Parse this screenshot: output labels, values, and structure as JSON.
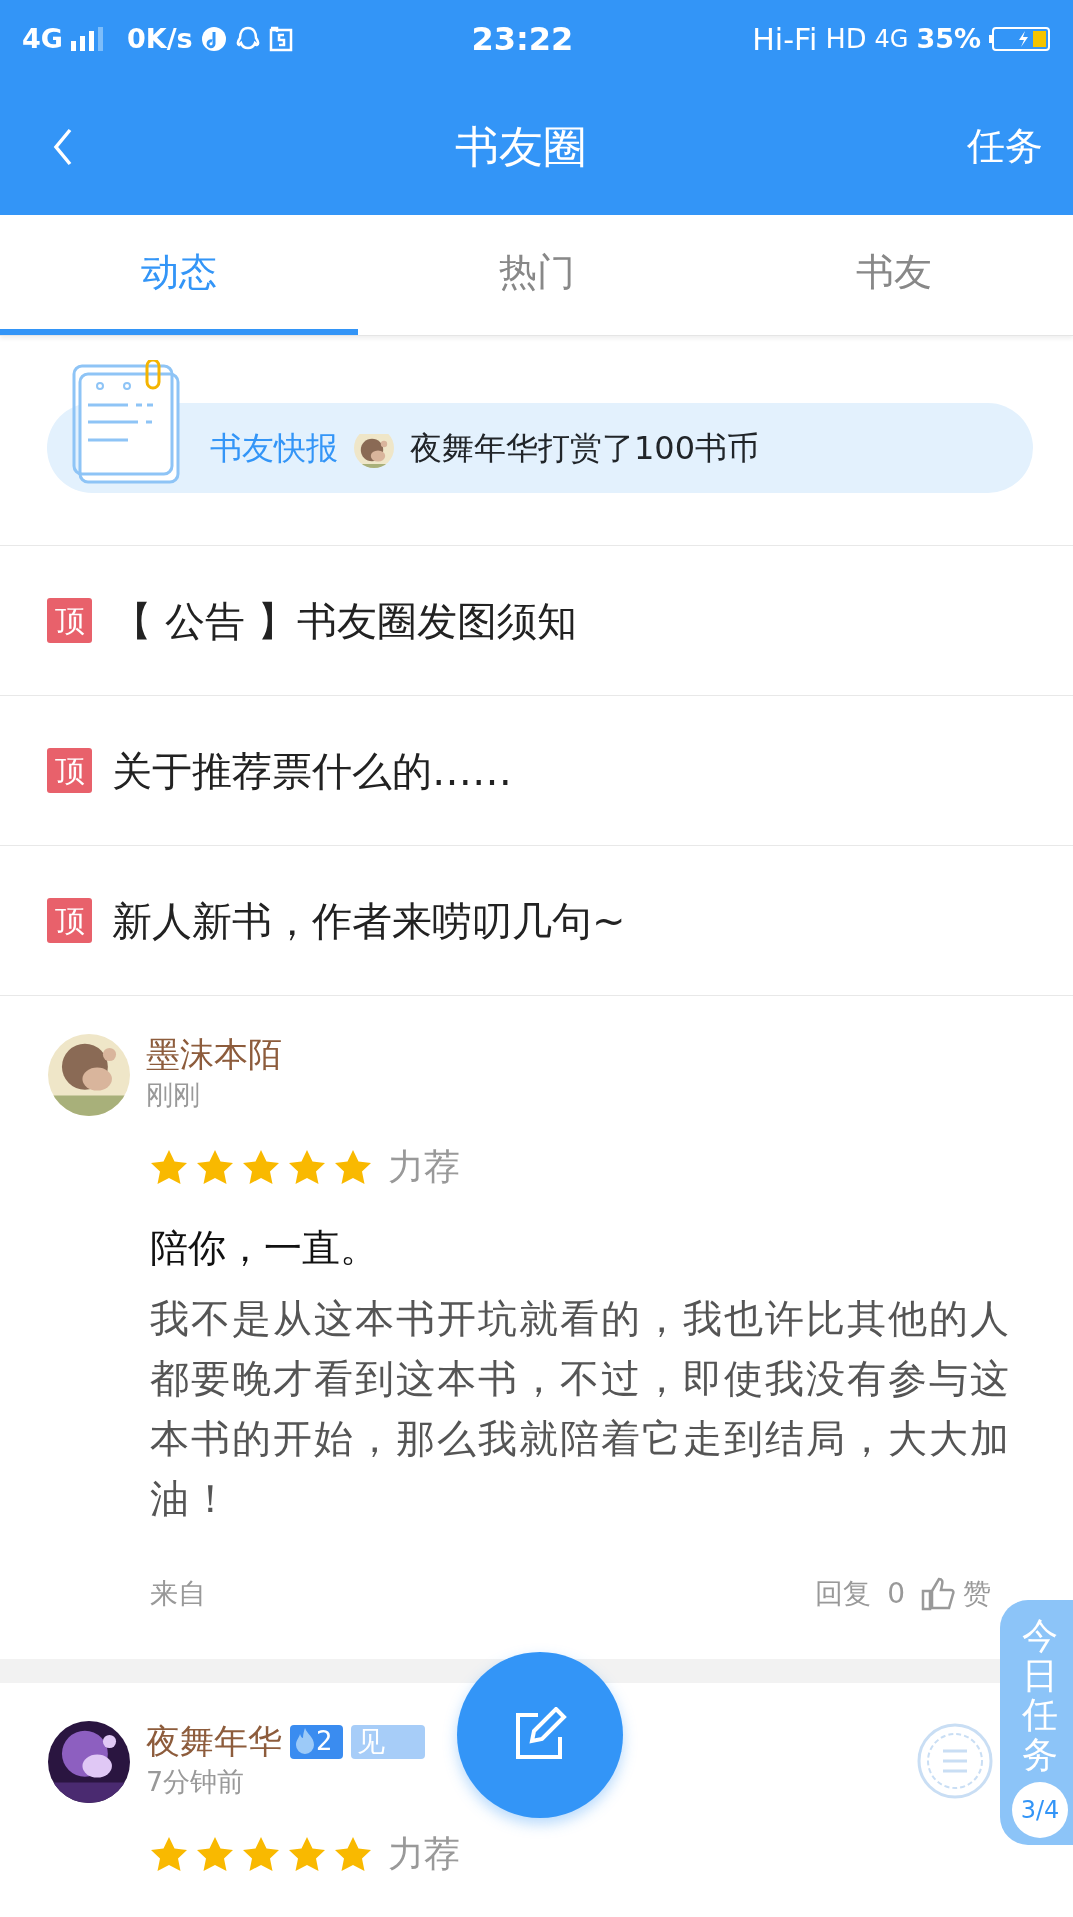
{
  "status_bar": {
    "network": "4G",
    "speed": "0K/s",
    "time": "23:22",
    "hifi": "Hi-Fi",
    "hd": "HD",
    "network_right": "4G",
    "battery": "35%"
  },
  "header": {
    "title": "书友圈",
    "action": "任务"
  },
  "tabs": [
    {
      "label": "动态",
      "selected": true
    },
    {
      "label": "热门",
      "selected": false
    },
    {
      "label": "书友",
      "selected": false
    }
  ],
  "news": {
    "label": "书友快报",
    "text": "夜舞年华打赏了100书币"
  },
  "pinned": [
    {
      "badge": "顶",
      "title": "【 公告 】书友圈发图须知"
    },
    {
      "badge": "顶",
      "title": "关于推荐票什么的……"
    },
    {
      "badge": "顶",
      "title": "新人新书，作者来唠叨几句~"
    }
  ],
  "posts": [
    {
      "user": "墨沫本陌",
      "time": "刚刚",
      "stars": 5,
      "rating": "力荐",
      "title": "陪你，一直。",
      "body": "我不是从这本书开坑就看的，我也许比其他的人都要晚才看到这本书，不过，即使我没有参与这本书的开始，那么我就陪着它走到结局，大大加油！",
      "source": "来自",
      "reply": "回复",
      "reply_count": "0",
      "like": "赞"
    },
    {
      "user": "夜舞年华",
      "fan_level": "2",
      "title_badge": "见",
      "time": "7分钟前",
      "stars": 5,
      "rating": "力荐",
      "stamp": true
    }
  ],
  "task_tab": {
    "label": "今日任务",
    "progress": "3/4"
  }
}
